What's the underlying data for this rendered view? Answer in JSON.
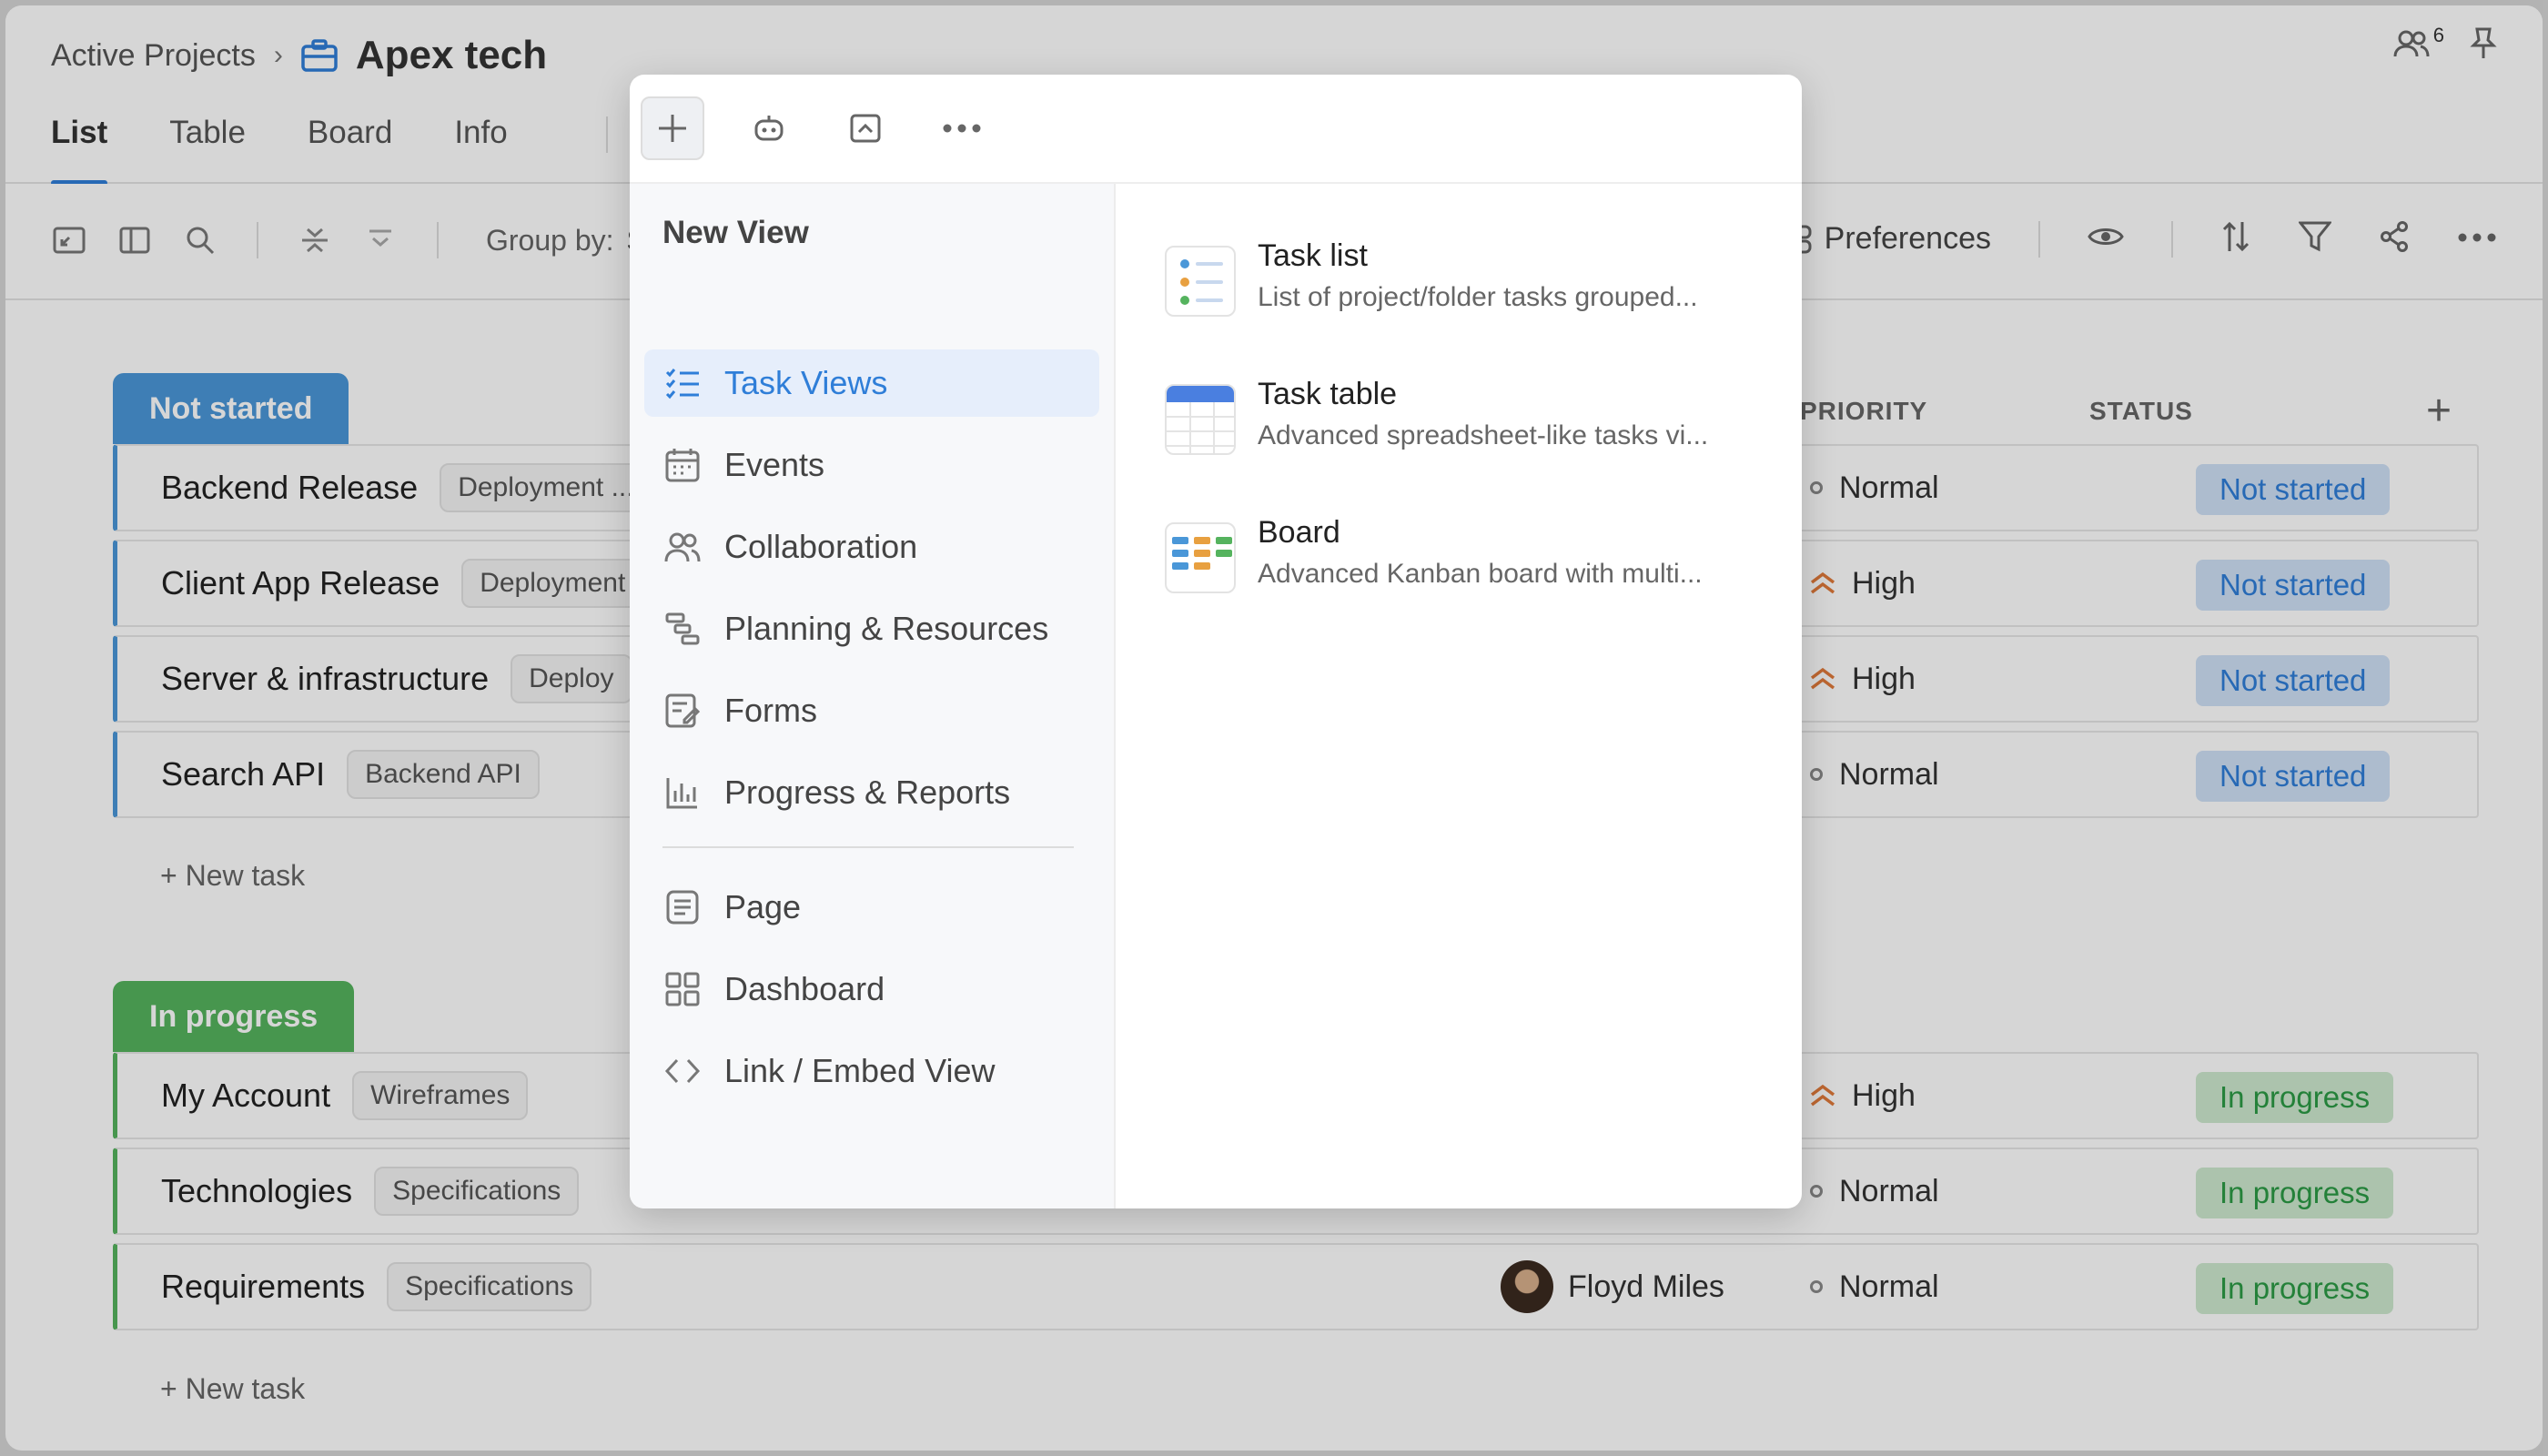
{
  "breadcrumb": {
    "parent": "Active Projects",
    "project": "Apex tech"
  },
  "tabs": [
    "List",
    "Table",
    "Board",
    "Info"
  ],
  "header": {
    "users_count": "6"
  },
  "toolbar": {
    "group_by_label": "Group by:",
    "group_by_value": "St",
    "preferences_label": "Preferences"
  },
  "columns": {
    "priority": "PRIORITY",
    "status": "STATUS"
  },
  "groups": [
    {
      "label": "Not started",
      "color": "#4a97d8",
      "rows": [
        {
          "name": "Backend Release",
          "tag": "Deployment ...",
          "priority": "Normal",
          "status": "Not started"
        },
        {
          "name": "Client App Release",
          "tag": "Deployment",
          "priority": "High",
          "status": "Not started"
        },
        {
          "name": "Server & infrastructure",
          "tag": "Deploy",
          "priority": "High",
          "status": "Not started"
        },
        {
          "name": "Search API",
          "tag": "Backend API",
          "priority": "Normal",
          "status": "Not started"
        }
      ],
      "new_task": "+ New task"
    },
    {
      "label": "In progress",
      "color": "#55b35e",
      "rows": [
        {
          "name": "My Account",
          "tag": "Wireframes",
          "priority": "High",
          "status": "In progress"
        },
        {
          "name": "Technologies",
          "tag": "Specifications",
          "priority": "Normal",
          "status": "In progress"
        },
        {
          "name": "Requirements",
          "tag": "Specifications",
          "priority": "Normal",
          "status": "In progress",
          "assignee": "Floyd Miles"
        }
      ],
      "new_task": "+ New task"
    }
  ],
  "popup": {
    "menu_title": "New View",
    "menu_items": [
      "Task Views",
      "Events",
      "Collaboration",
      "Planning & Resources",
      "Forms",
      "Progress & Reports"
    ],
    "menu_items_2": [
      "Page",
      "Dashboard",
      "Link / Embed View"
    ],
    "views": [
      {
        "title": "Task list",
        "desc": "List of project/folder tasks grouped..."
      },
      {
        "title": "Task table",
        "desc": "Advanced spreadsheet-like tasks vi..."
      },
      {
        "title": "Board",
        "desc": "Advanced Kanban board with multi..."
      }
    ]
  },
  "colors": {
    "accent": "#2f7ed8",
    "not_started": "#4a97d8",
    "in_progress": "#55b35e",
    "high_priority": "#e07a3b"
  }
}
